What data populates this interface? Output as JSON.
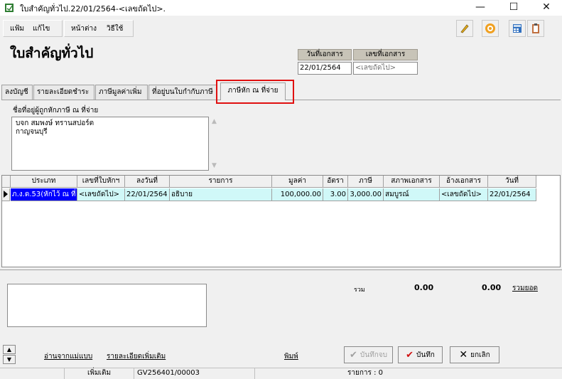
{
  "window": {
    "title": "ใบสำคัญทั่วไป.22/01/2564-<เลขถัดไป>.",
    "minimize": "—",
    "maximize": "☐",
    "close": "✕"
  },
  "menu": {
    "file": "แฟ้ม",
    "edit": "แก้ไข",
    "window": "หน้าต่าง",
    "help": "วิธีใช้"
  },
  "toolbar": {
    "icons": [
      "pencil-icon",
      "target-icon",
      "calculator-icon",
      "clipboard-icon"
    ]
  },
  "header": {
    "page_title": "ใบสำคัญทั่วไป",
    "doc_date_label": "วันที่เอกสาร",
    "doc_date_value": "22/01/2564",
    "doc_no_label": "เลขที่เอกสาร",
    "doc_no_value": "<เลขถัดไป>"
  },
  "tabs": [
    {
      "label": "ลงบัญชี"
    },
    {
      "label": "รายละเอียดชำระ"
    },
    {
      "label": "ภาษีมูลค่าเพิ่ม"
    },
    {
      "label": "ที่อยู่บนใบกำกับภาษี"
    },
    {
      "label": "ภาษีหัก ณ ที่จ่าย",
      "active": true
    }
  ],
  "withholding": {
    "address_label": "ชื่อที่อยู่ผู้ถูกหักภาษี ณ ที่จ่าย",
    "address_line1": "บจก สมพงษ์ ทรานสปอร์ต",
    "address_line2": "กาญจนบุรี"
  },
  "grid": {
    "columns": [
      "ประเภท",
      "เลขที่ใบหักฯ",
      "ลงวันที่",
      "รายการ",
      "มูลค่า",
      "อัตรา",
      "ภาษี",
      "สภาพเอกสาร",
      "อ้างเอกสาร",
      "วันที่"
    ],
    "rows": [
      [
        "ภ.ง.ด.53(หักไว้ ณ ที่",
        "<เลขถัดไป>",
        "22/01/2564",
        "อธิบาย",
        "100,000.00",
        "3.00",
        "3,000.00",
        "สมบูรณ์",
        "<เลขถัดไป>",
        "22/01/2564"
      ]
    ]
  },
  "summary": {
    "total_label": "รวม",
    "total1": "0.00",
    "total2": "0.00",
    "total_link": "รวมยอด"
  },
  "links": {
    "read_template": "อ่านจากแม่แบบ",
    "more_details": "รายละเอียดเพิ่มเติม",
    "print": "พิมพ์"
  },
  "buttons": {
    "save_print": "บันทึกจบ",
    "save": "บันทึก",
    "cancel": "ยกเลิก"
  },
  "status": {
    "mode": "เพิ่มเติม",
    "doc_id": "GV256401/00003",
    "items": "รายการ : 0"
  },
  "colors": {
    "selection": "#0000ff",
    "row_highlight": "#d0f8f8",
    "callout": "#e01010"
  }
}
